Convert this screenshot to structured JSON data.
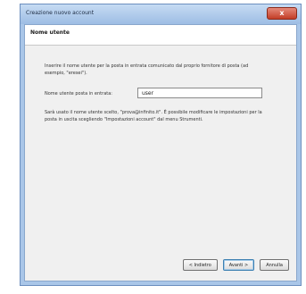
{
  "window": {
    "title": "Creazione nuovo account",
    "close_label": "x"
  },
  "header": {
    "title": "Nome utente"
  },
  "content": {
    "intro": "Inserire il nome utente per la posta in entrata comunicato dal proprio fornitore di posta (ad esempio, \"eresei\").",
    "field_label": "Nome utente posta in entrata:",
    "field_value": "user",
    "note": "Sarà usato il nome utente scelto, \"prova@infinito.it\". È possibile modificare le impostazioni per la posta in uscita scegliendo \"Impostazioni account\" dal menu Strumenti."
  },
  "buttons": {
    "back": "< Indietro",
    "next": "Avanti >",
    "cancel": "Annulla"
  }
}
